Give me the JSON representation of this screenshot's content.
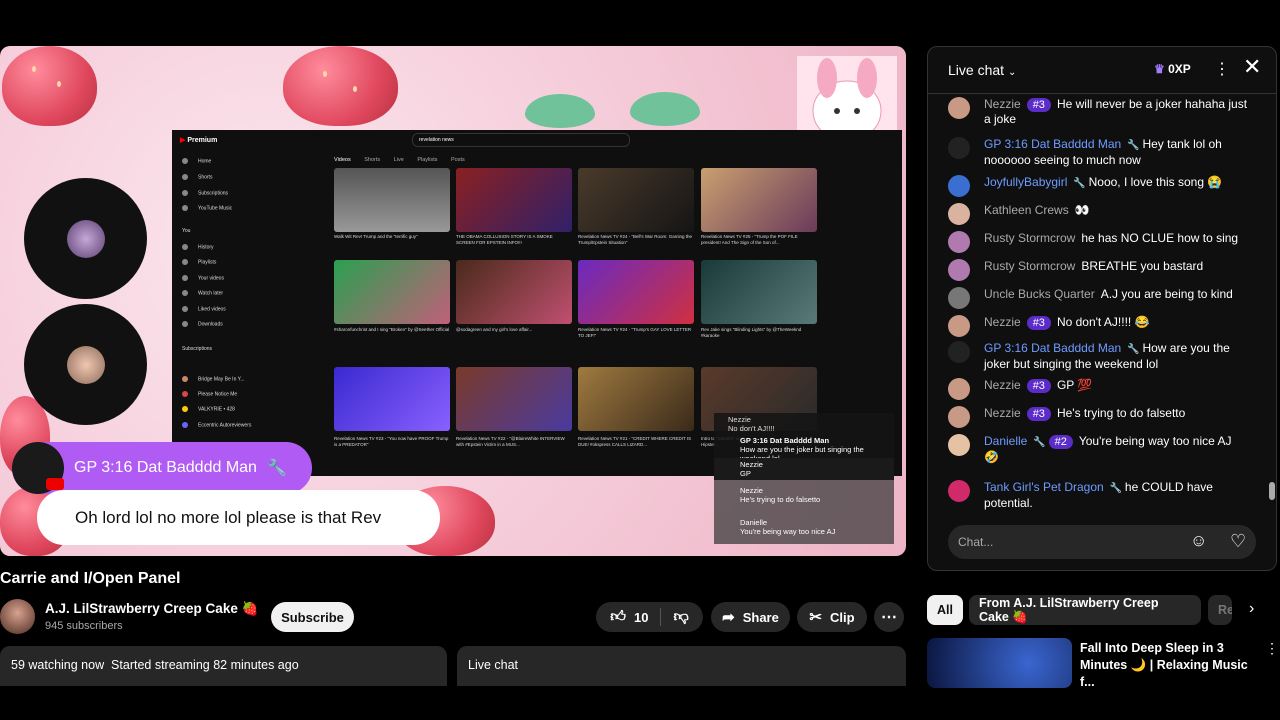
{
  "video": {
    "screen": {
      "logo": "Premium",
      "search": "revelation news",
      "tabs": [
        "Videos",
        "Shorts",
        "Live",
        "Playlists",
        "Posts"
      ],
      "sidebar": [
        "Home",
        "Shorts",
        "Subscriptions",
        "YouTube Music",
        "You",
        "History",
        "Playlists",
        "Your videos",
        "Watch later",
        "Liked videos",
        "Downloads",
        "Subscriptions",
        "Bridge May Be In Y...",
        "Please Notice Me",
        "VALKYRIE • 428",
        "Eccentric Autoreviewers"
      ],
      "rows": [
        [
          "Walk Wit Rev! Trump and the \"terrific guy\"",
          "THE OBAMA COLLUSION STORY IS A SMOKE SCREEN FOR EPSTEIN INFO!!!",
          "Revelation News TV #24 - \"Bell's War Room: Gaming the Trump/Epstein Situation\"",
          "Revelation News TV #25 - \"Trump the POF FILE president! And The Sign of the Son of..."
        ],
        [
          "#sharonfunchrist and I sing \"Broken\" by @Seether Official",
          "@sodagreen and my girl's love affair...",
          "Revelation News TV #24 - \"Trump's GAY LOVE LETTER TO JEF!\"",
          "Rev Jake sings \"Blinding Lights\" by @TheWeeknd #karaoke"
        ],
        [
          "Revelation News TV #23 - \"You now have PROOF Trump is a PREDATOR\"",
          "Revelation News TV #22 - \"@BlaireWhite INTERVIEW with #Epstein Victim in a MUS...",
          "Revelation News TV #21 - \"CREDIT WHERE CREDIT IS DUE! #okspress CALLS LIZARD...",
          "Intro to \"Sinners\" and Hipster..."
        ]
      ]
    },
    "overlay_name": "GP 3:16 Dat Badddd Man",
    "overlay_message": "Oh lord lol no more lol please is that Rev",
    "mini_chat": [
      {
        "name": "Nezzie",
        "text": "No don't AJ!!!!"
      },
      {
        "name": "GP 3:16 Dat Badddd Man",
        "text": "How are you the joker but singing the weekend lol"
      },
      {
        "name": "Nezzie",
        "text": "GP"
      },
      {
        "name": "Nezzie",
        "text": "He's trying to do falsetto"
      },
      {
        "name": "Danielle",
        "text": "You're being way too nice AJ"
      }
    ]
  },
  "title": "Carrie and I/Open Panel",
  "channel": {
    "name": "A.J. LilStrawberry Creep Cake 🍓",
    "subscribers": "945 subscribers",
    "subscribe": "Subscribe"
  },
  "actions": {
    "likes": "10",
    "share": "Share",
    "clip": "Clip"
  },
  "description": "59 watching now  Started streaming 82 minutes ago",
  "livechat_box": "Live chat",
  "chat": {
    "title": "Live chat",
    "xp": "0XP",
    "input_placeholder": "Chat...",
    "messages": [
      {
        "name": "Nezzie",
        "badge": "#3",
        "mod": false,
        "text": "He will never be a joker hahaha just a joke",
        "color": "#c89a86"
      },
      {
        "name": "GP 3:16 Dat Badddd Man",
        "badge": "",
        "mod": true,
        "text": "Hey tank lol oh noooooo seeing to much now",
        "color": "#222"
      },
      {
        "name": "JoyfullyBabygirl",
        "badge": "",
        "mod": true,
        "text": "Nooo, I love this song 😭",
        "color": "#3a6fd1"
      },
      {
        "name": "Kathleen Crews",
        "badge": "",
        "mod": false,
        "text": "👀",
        "color": "#d9b39f"
      },
      {
        "name": "Rusty Stormcrow",
        "badge": "",
        "mod": false,
        "text": "he has NO CLUE how to sing",
        "color": "#b07ab0"
      },
      {
        "name": "Rusty Stormcrow",
        "badge": "",
        "mod": false,
        "text": "BREATHE you bastard",
        "color": "#b07ab0"
      },
      {
        "name": "Uncle Bucks Quarter",
        "badge": "",
        "mod": false,
        "text": "A.J you are being to kind",
        "color": "#777"
      },
      {
        "name": "Nezzie",
        "badge": "#3",
        "mod": false,
        "text": "No don't AJ!!!! 😂",
        "color": "#c89a86"
      },
      {
        "name": "GP 3:16 Dat Badddd Man",
        "badge": "",
        "mod": true,
        "text": "How are you the joker but singing the weekend lol",
        "color": "#222"
      },
      {
        "name": "Nezzie",
        "badge": "#3",
        "mod": false,
        "text": "GP 💯",
        "color": "#c89a86"
      },
      {
        "name": "Nezzie",
        "badge": "#3",
        "mod": false,
        "text": "He's trying to do falsetto",
        "color": "#c89a86"
      },
      {
        "name": "Danielle",
        "badge": "#2",
        "mod": true,
        "text": "You're being way too nice AJ 🤣",
        "color": "#e6c2a4"
      },
      {
        "name": "Tank Girl's Pet Dragon",
        "badge": "",
        "mod": true,
        "text": "he COULD have potential.",
        "color": "#d02a6a"
      }
    ]
  },
  "chips": {
    "all": "All",
    "from": "From A.J. LilStrawberry Creep Cake 🍓",
    "more": "Re"
  },
  "recommendation": {
    "title": "Fall Into Deep Sleep in 3 Minutes 🌙 | Relaxing Music f..."
  }
}
